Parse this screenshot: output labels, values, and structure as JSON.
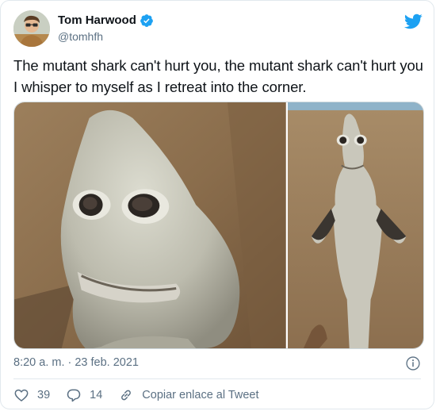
{
  "author": {
    "display_name": "Tom Harwood",
    "handle": "@tomhfh",
    "verified": true
  },
  "tweet": {
    "text": "The mutant shark can't hurt you, the mutant shark can't hurt you I whisper to myself as I retreat into the corner.",
    "timestamp": "8:20 a. m. · 23 feb. 2021"
  },
  "actions": {
    "likes": "39",
    "replies": "14",
    "copy_link_label": "Copiar enlace al Tweet"
  },
  "icons": {
    "brand": "twitter-bird-icon",
    "verified": "verified-badge-icon",
    "info": "info-icon",
    "like": "heart-icon",
    "reply": "reply-bubble-icon",
    "link": "link-icon"
  },
  "colors": {
    "brand_blue": "#1da1f2",
    "secondary_text": "#5b7083",
    "primary_text": "#0f1419",
    "border": "#e1e8ed"
  }
}
